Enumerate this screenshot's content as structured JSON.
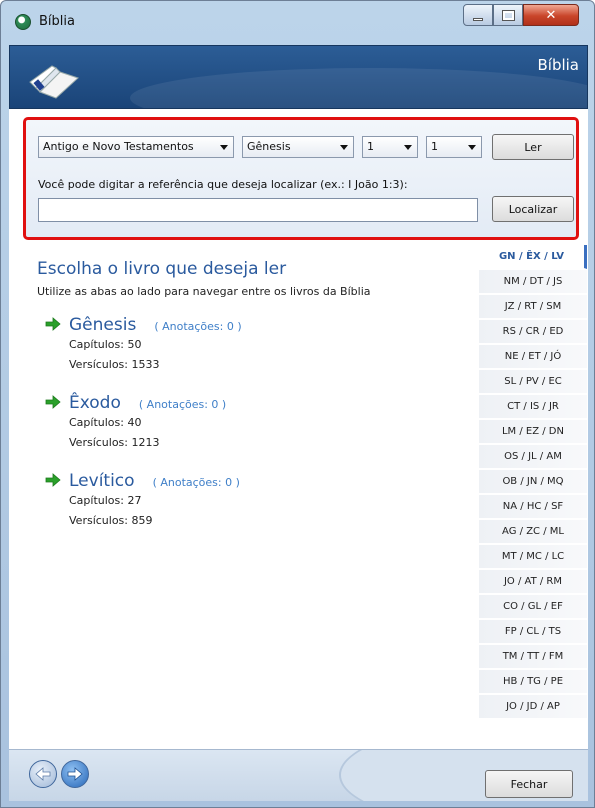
{
  "window": {
    "title": "Bíblia"
  },
  "banner": {
    "title": "Bíblia"
  },
  "search": {
    "testament_select": "Antigo e Novo Testamentos",
    "book_select": "Gênesis",
    "chapter_select": "1",
    "verse_select": "1",
    "read_button": "Ler",
    "hint": "Você pode digitar a referência que deseja localizar (ex.: I João 1:3):",
    "reference_value": "",
    "locate_button": "Localizar"
  },
  "content": {
    "heading": "Escolha o livro que deseja ler",
    "subheading": "Utilize as abas ao lado para navegar entre os livros da Bíblia",
    "books": [
      {
        "name": "Gênesis",
        "notes": "( Anotações: 0 )",
        "chapters": "Capítulos:  50",
        "verses": "Versículos: 1533"
      },
      {
        "name": "Êxodo",
        "notes": "( Anotações: 0 )",
        "chapters": "Capítulos:  40",
        "verses": "Versículos: 1213"
      },
      {
        "name": "Levítico",
        "notes": "( Anotações: 0 )",
        "chapters": "Capítulos:  27",
        "verses": "Versículos: 859"
      }
    ]
  },
  "tabs": [
    "GN / ÊX / LV",
    "NM / DT / JS",
    "JZ / RT / SM",
    "RS / CR / ED",
    "NE / ET / JÓ",
    "SL / PV / EC",
    "CT / IS / JR",
    "LM / EZ / DN",
    "OS / JL / AM",
    "OB / JN / MQ",
    "NA / HC / SF",
    "AG / ZC / ML",
    "MT / MC / LC",
    "JO / AT / RM",
    "CO / GL / EF",
    "FP / CL / TS",
    "TM / TT / FM",
    "HB / TG / PE",
    "JO / JD / AP"
  ],
  "active_tab_index": 0,
  "footer": {
    "close_button": "Fechar"
  },
  "colors": {
    "highlight_border": "#e01010",
    "link_blue": "#2a5a9e",
    "arrow_green": "#2aa02a"
  }
}
